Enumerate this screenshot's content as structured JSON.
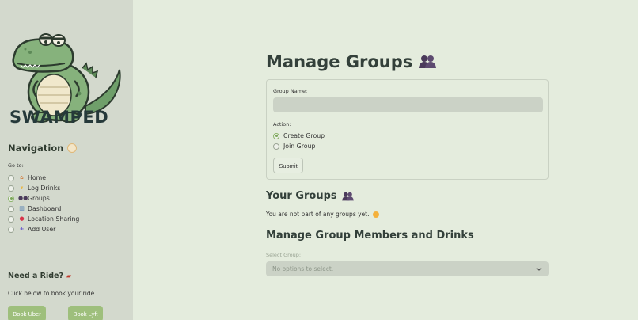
{
  "brand": "SWAMPED",
  "sidebar": {
    "nav_title": "Navigation",
    "goto_label": "Go to:",
    "items": [
      {
        "label": "Home",
        "icon": "house-icon",
        "selected": false
      },
      {
        "label": "Log Drinks",
        "icon": "drink-icon",
        "selected": false
      },
      {
        "label": "Groups",
        "icon": "people-icon",
        "selected": true
      },
      {
        "label": "Dashboard",
        "icon": "chart-icon",
        "selected": false
      },
      {
        "label": "Location Sharing",
        "icon": "pin-icon",
        "selected": false
      },
      {
        "label": "Add User",
        "icon": "plus-icon",
        "selected": false
      }
    ],
    "ride_title": "Need a Ride?",
    "ride_text": "Click below to book your ride.",
    "uber_label": "Book Uber",
    "lyft_label": "Book Lyft"
  },
  "main": {
    "title": "Manage Groups",
    "group_name_label": "Group Name:",
    "group_name_value": "",
    "action_label": "Action:",
    "options": [
      {
        "label": "Create Group",
        "selected": true
      },
      {
        "label": "Join Group",
        "selected": false
      }
    ],
    "submit_label": "Submit",
    "your_groups_title": "Your Groups",
    "no_groups_text": "You are not part of any groups yet.",
    "manage_title": "Manage Group Members and Drinks",
    "select_group_label": "Select Group:",
    "select_placeholder": "No options to select."
  },
  "colors": {
    "sidebar_bg": "#d3d9cd",
    "main_bg": "#e4ecdd",
    "accent": "#9ebf7c"
  }
}
